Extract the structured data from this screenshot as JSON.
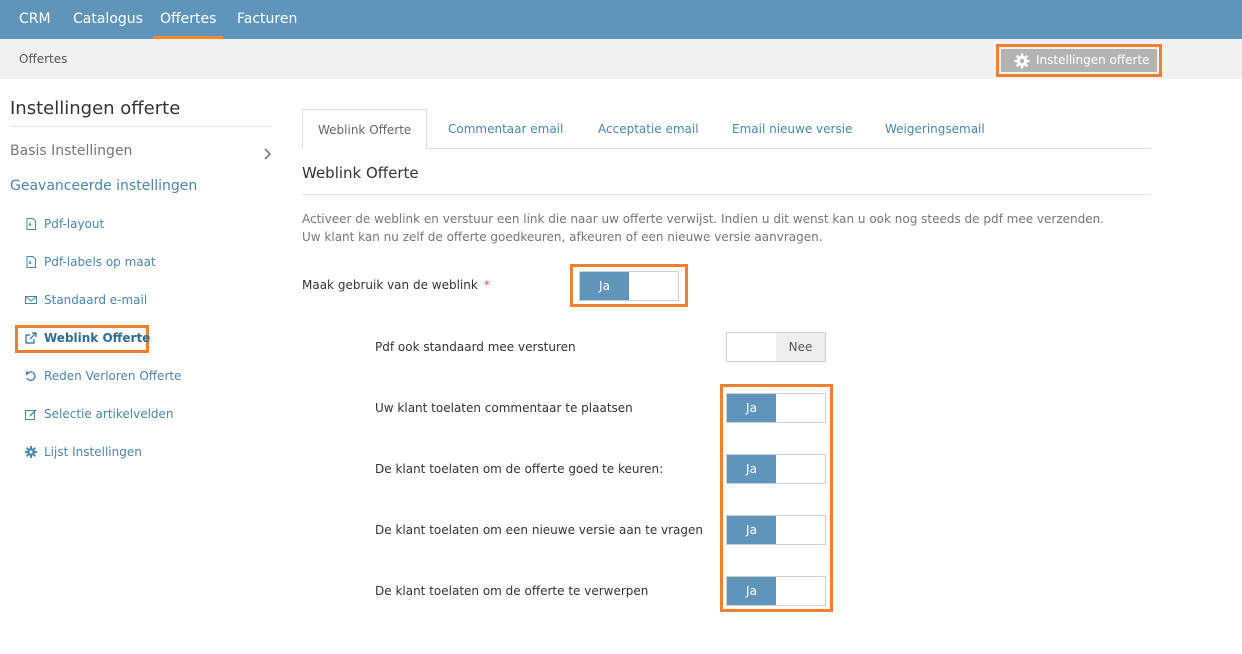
{
  "topnav": {
    "items": [
      {
        "label": "CRM",
        "active": false
      },
      {
        "label": "Catalogus",
        "active": false
      },
      {
        "label": "Offertes",
        "active": true
      },
      {
        "label": "Facturen",
        "active": false
      }
    ]
  },
  "subbar": {
    "breadcrumb": "Offertes",
    "settings_button": {
      "label": "Instellingen offerte",
      "icon": "gear-icon"
    }
  },
  "sidebar": {
    "title": "Instellingen offerte",
    "basis": "Basis Instellingen",
    "advanced": "Geavanceerde instellingen",
    "items": [
      {
        "label": "Pdf-layout",
        "icon": "pdf-file-icon"
      },
      {
        "label": "Pdf-labels op maat",
        "icon": "pdf-file-icon"
      },
      {
        "label": "Standaard e-mail",
        "icon": "envelope-icon"
      },
      {
        "label": "Weblink Offerte",
        "icon": "external-link-icon",
        "active": true
      },
      {
        "label": "Reden Verloren Offerte",
        "icon": "undo-icon"
      },
      {
        "label": "Selectie artikelvelden",
        "icon": "edit-icon"
      },
      {
        "label": "Lijst Instellingen",
        "icon": "cog-icon"
      }
    ]
  },
  "tabs": [
    {
      "label": "Weblink Offerte",
      "active": true
    },
    {
      "label": "Commentaar email"
    },
    {
      "label": "Acceptatie email"
    },
    {
      "label": "Email nieuwe versie"
    },
    {
      "label": "Weigeringsemail"
    }
  ],
  "section": {
    "title": "Weblink Offerte",
    "description_line1": "Activeer de weblink en verstuur een link die naar uw offerte verwijst. Indien u dit wenst kan u ook nog steeds de pdf mee verzenden.",
    "description_line2": "Uw klant kan nu zelf de offerte goedkeuren, afkeuren of een nieuwe versie aanvragen."
  },
  "fields": {
    "main": {
      "label": "Maak gebruik van de weblink",
      "required_mark": "*",
      "value_label": "Ja",
      "on": true
    },
    "pdf": {
      "label": "Pdf ook standaard mee versturen",
      "value_label": "Nee",
      "on": false
    },
    "comment": {
      "label": "Uw klant toelaten commentaar te plaatsen",
      "value_label": "Ja",
      "on": true
    },
    "approve": {
      "label": "De klant toelaten om de offerte goed te keuren:",
      "value_label": "Ja",
      "on": true
    },
    "new_version": {
      "label": "De klant toelaten om een nieuwe versie aan te vragen",
      "value_label": "Ja",
      "on": true
    },
    "reject": {
      "label": "De klant toelaten om de offerte te verwerpen",
      "value_label": "Ja",
      "on": true
    }
  },
  "colors": {
    "primary": "#5f95ba",
    "highlight": "#f07f2e",
    "link": "#4a86ad"
  }
}
